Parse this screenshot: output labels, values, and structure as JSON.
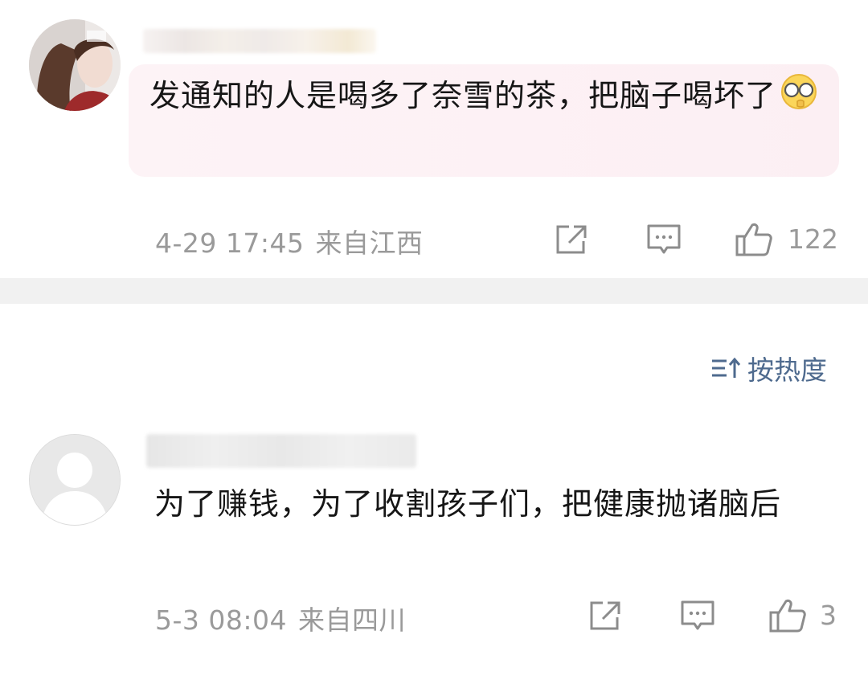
{
  "comments": [
    {
      "text": "发通知的人是喝多了奈雪的茶，把脑子喝坏了",
      "emoji": "glasses-face-emoji",
      "date": "4-29 17:45",
      "location": "来自江西",
      "likes": "122"
    },
    {
      "text": "为了赚钱，为了收割孩子们，把健康抛诸脑后",
      "date": "5-3 08:04",
      "location": "来自四川",
      "likes": "3"
    }
  ],
  "sort": {
    "label": "按热度",
    "icon": "sort-icon"
  },
  "icons": {
    "share": "share-icon",
    "reply": "comment-icon",
    "like": "thumbs-up-icon"
  },
  "colors": {
    "meta_gray": "#9a9a9a",
    "sort_blue": "#4e6a8e",
    "bubble_pink": "#fdf1f5",
    "divider": "#f1f1f1"
  }
}
